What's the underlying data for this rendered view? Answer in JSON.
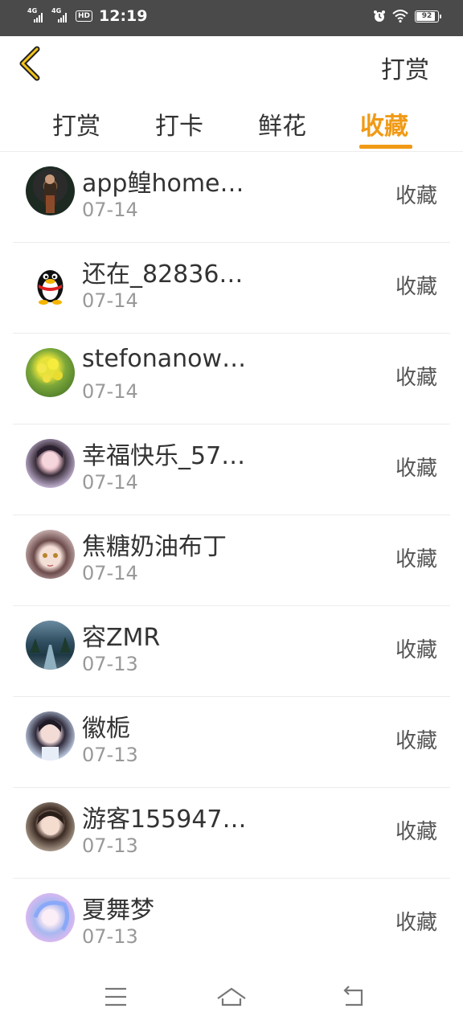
{
  "status": {
    "net1": "4G",
    "net2": "4G",
    "hd": "HD",
    "time": "12:19",
    "battery": "92"
  },
  "header": {
    "action_label": "打赏"
  },
  "tabs": [
    {
      "label": "打赏"
    },
    {
      "label": "打卡"
    },
    {
      "label": "鲜花"
    },
    {
      "label": "收藏",
      "active": true
    }
  ],
  "colors": {
    "accent": "#f09a16",
    "text": "#333333",
    "muted": "#999999",
    "statusbar": "#4a4a4a"
  },
  "list": [
    {
      "name": "app鳇home…",
      "date": "07-14",
      "action": "收藏"
    },
    {
      "name": "还在_82836…",
      "date": "07-14",
      "action": "收藏"
    },
    {
      "name": "stefonanow…",
      "date": "07-14",
      "action": "收藏"
    },
    {
      "name": "幸福快乐_57…",
      "date": "07-14",
      "action": "收藏"
    },
    {
      "name": "焦糖奶油布丁",
      "date": "07-14",
      "action": "收藏"
    },
    {
      "name": "容ZMR",
      "date": "07-13",
      "action": "收藏"
    },
    {
      "name": "徽栀",
      "date": "07-13",
      "action": "收藏"
    },
    {
      "name": "游客155947…",
      "date": "07-13",
      "action": "收藏"
    },
    {
      "name": "夏舞梦",
      "date": "07-13",
      "action": "收藏"
    }
  ],
  "navbar": {
    "icons": [
      "menu-icon",
      "home-icon",
      "back-icon"
    ]
  }
}
